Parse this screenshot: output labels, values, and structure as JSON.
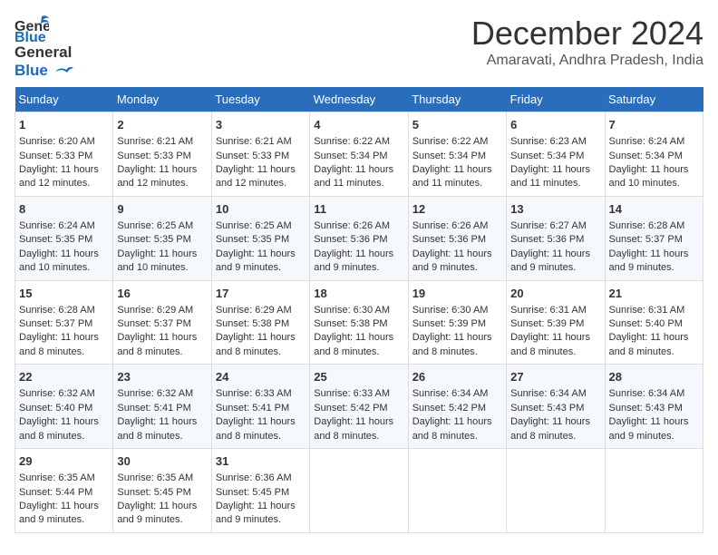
{
  "logo": {
    "line1": "General",
    "line2": "Blue"
  },
  "title": "December 2024",
  "subtitle": "Amaravati, Andhra Pradesh, India",
  "days_header": [
    "Sunday",
    "Monday",
    "Tuesday",
    "Wednesday",
    "Thursday",
    "Friday",
    "Saturday"
  ],
  "weeks": [
    [
      {
        "day": "1",
        "lines": [
          "Sunrise: 6:20 AM",
          "Sunset: 5:33 PM",
          "Daylight: 11 hours",
          "and 12 minutes."
        ]
      },
      {
        "day": "2",
        "lines": [
          "Sunrise: 6:21 AM",
          "Sunset: 5:33 PM",
          "Daylight: 11 hours",
          "and 12 minutes."
        ]
      },
      {
        "day": "3",
        "lines": [
          "Sunrise: 6:21 AM",
          "Sunset: 5:33 PM",
          "Daylight: 11 hours",
          "and 12 minutes."
        ]
      },
      {
        "day": "4",
        "lines": [
          "Sunrise: 6:22 AM",
          "Sunset: 5:34 PM",
          "Daylight: 11 hours",
          "and 11 minutes."
        ]
      },
      {
        "day": "5",
        "lines": [
          "Sunrise: 6:22 AM",
          "Sunset: 5:34 PM",
          "Daylight: 11 hours",
          "and 11 minutes."
        ]
      },
      {
        "day": "6",
        "lines": [
          "Sunrise: 6:23 AM",
          "Sunset: 5:34 PM",
          "Daylight: 11 hours",
          "and 11 minutes."
        ]
      },
      {
        "day": "7",
        "lines": [
          "Sunrise: 6:24 AM",
          "Sunset: 5:34 PM",
          "Daylight: 11 hours",
          "and 10 minutes."
        ]
      }
    ],
    [
      {
        "day": "8",
        "lines": [
          "Sunrise: 6:24 AM",
          "Sunset: 5:35 PM",
          "Daylight: 11 hours",
          "and 10 minutes."
        ]
      },
      {
        "day": "9",
        "lines": [
          "Sunrise: 6:25 AM",
          "Sunset: 5:35 PM",
          "Daylight: 11 hours",
          "and 10 minutes."
        ]
      },
      {
        "day": "10",
        "lines": [
          "Sunrise: 6:25 AM",
          "Sunset: 5:35 PM",
          "Daylight: 11 hours",
          "and 9 minutes."
        ]
      },
      {
        "day": "11",
        "lines": [
          "Sunrise: 6:26 AM",
          "Sunset: 5:36 PM",
          "Daylight: 11 hours",
          "and 9 minutes."
        ]
      },
      {
        "day": "12",
        "lines": [
          "Sunrise: 6:26 AM",
          "Sunset: 5:36 PM",
          "Daylight: 11 hours",
          "and 9 minutes."
        ]
      },
      {
        "day": "13",
        "lines": [
          "Sunrise: 6:27 AM",
          "Sunset: 5:36 PM",
          "Daylight: 11 hours",
          "and 9 minutes."
        ]
      },
      {
        "day": "14",
        "lines": [
          "Sunrise: 6:28 AM",
          "Sunset: 5:37 PM",
          "Daylight: 11 hours",
          "and 9 minutes."
        ]
      }
    ],
    [
      {
        "day": "15",
        "lines": [
          "Sunrise: 6:28 AM",
          "Sunset: 5:37 PM",
          "Daylight: 11 hours",
          "and 8 minutes."
        ]
      },
      {
        "day": "16",
        "lines": [
          "Sunrise: 6:29 AM",
          "Sunset: 5:37 PM",
          "Daylight: 11 hours",
          "and 8 minutes."
        ]
      },
      {
        "day": "17",
        "lines": [
          "Sunrise: 6:29 AM",
          "Sunset: 5:38 PM",
          "Daylight: 11 hours",
          "and 8 minutes."
        ]
      },
      {
        "day": "18",
        "lines": [
          "Sunrise: 6:30 AM",
          "Sunset: 5:38 PM",
          "Daylight: 11 hours",
          "and 8 minutes."
        ]
      },
      {
        "day": "19",
        "lines": [
          "Sunrise: 6:30 AM",
          "Sunset: 5:39 PM",
          "Daylight: 11 hours",
          "and 8 minutes."
        ]
      },
      {
        "day": "20",
        "lines": [
          "Sunrise: 6:31 AM",
          "Sunset: 5:39 PM",
          "Daylight: 11 hours",
          "and 8 minutes."
        ]
      },
      {
        "day": "21",
        "lines": [
          "Sunrise: 6:31 AM",
          "Sunset: 5:40 PM",
          "Daylight: 11 hours",
          "and 8 minutes."
        ]
      }
    ],
    [
      {
        "day": "22",
        "lines": [
          "Sunrise: 6:32 AM",
          "Sunset: 5:40 PM",
          "Daylight: 11 hours",
          "and 8 minutes."
        ]
      },
      {
        "day": "23",
        "lines": [
          "Sunrise: 6:32 AM",
          "Sunset: 5:41 PM",
          "Daylight: 11 hours",
          "and 8 minutes."
        ]
      },
      {
        "day": "24",
        "lines": [
          "Sunrise: 6:33 AM",
          "Sunset: 5:41 PM",
          "Daylight: 11 hours",
          "and 8 minutes."
        ]
      },
      {
        "day": "25",
        "lines": [
          "Sunrise: 6:33 AM",
          "Sunset: 5:42 PM",
          "Daylight: 11 hours",
          "and 8 minutes."
        ]
      },
      {
        "day": "26",
        "lines": [
          "Sunrise: 6:34 AM",
          "Sunset: 5:42 PM",
          "Daylight: 11 hours",
          "and 8 minutes."
        ]
      },
      {
        "day": "27",
        "lines": [
          "Sunrise: 6:34 AM",
          "Sunset: 5:43 PM",
          "Daylight: 11 hours",
          "and 8 minutes."
        ]
      },
      {
        "day": "28",
        "lines": [
          "Sunrise: 6:34 AM",
          "Sunset: 5:43 PM",
          "Daylight: 11 hours",
          "and 9 minutes."
        ]
      }
    ],
    [
      {
        "day": "29",
        "lines": [
          "Sunrise: 6:35 AM",
          "Sunset: 5:44 PM",
          "Daylight: 11 hours",
          "and 9 minutes."
        ]
      },
      {
        "day": "30",
        "lines": [
          "Sunrise: 6:35 AM",
          "Sunset: 5:45 PM",
          "Daylight: 11 hours",
          "and 9 minutes."
        ]
      },
      {
        "day": "31",
        "lines": [
          "Sunrise: 6:36 AM",
          "Sunset: 5:45 PM",
          "Daylight: 11 hours",
          "and 9 minutes."
        ]
      },
      null,
      null,
      null,
      null
    ]
  ]
}
